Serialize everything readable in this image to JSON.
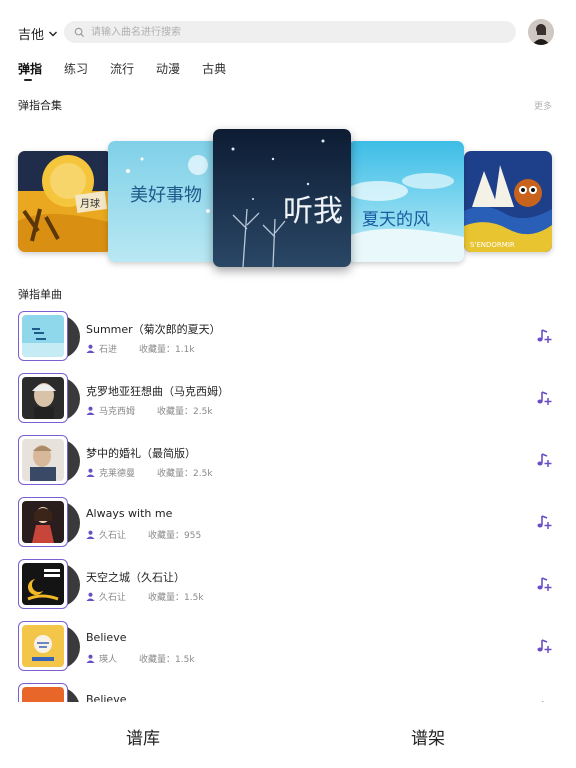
{
  "header": {
    "instrument_label": "吉他",
    "search_placeholder": "请输入曲名进行搜索"
  },
  "tabs": [
    {
      "label": "弹指",
      "active": true
    },
    {
      "label": "练习"
    },
    {
      "label": "流行"
    },
    {
      "label": "动漫"
    },
    {
      "label": "古典"
    }
  ],
  "collection": {
    "title": "弹指合集",
    "more_label": "更多",
    "covers": [
      {
        "text": "月球"
      },
      {
        "text": "美好事物"
      },
      {
        "text": "听我"
      },
      {
        "text": "夏天的风"
      },
      {
        "text": "S'ENDORMIR"
      }
    ]
  },
  "singles": {
    "title": "弹指单曲",
    "items": [
      {
        "title": "Summer（菊次郎的夏天）",
        "artist": "石进",
        "fav_label": "收藏量：1.1k"
      },
      {
        "title": "克罗地亚狂想曲（马克西姆）",
        "artist": "马克西姆",
        "fav_label": "收藏量：2.5k"
      },
      {
        "title": "梦中的婚礼（最简版）",
        "artist": "克莱德曼",
        "fav_label": "收藏量：2.5k"
      },
      {
        "title": "Always with me",
        "artist": "久石让",
        "fav_label": "收藏量：955"
      },
      {
        "title": "天空之城（久石让）",
        "artist": "久石让",
        "fav_label": "收藏量：1.5k"
      },
      {
        "title": "Believe",
        "artist": "瑛人",
        "fav_label": "收藏量：1.5k"
      },
      {
        "title": "Believe",
        "artist": "",
        "fav_label": ""
      }
    ]
  },
  "bottom_nav": {
    "library_label": "谱库",
    "shelf_label": "谱架"
  },
  "colors": {
    "accent": "#6a4fc4",
    "thumb_border": "#7b5fd0"
  }
}
